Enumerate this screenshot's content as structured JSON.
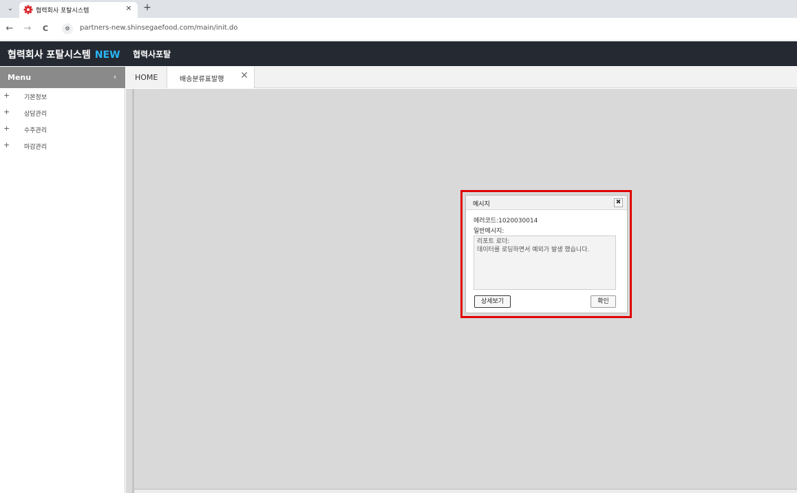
{
  "browser": {
    "tab_menu_glyph": "⌄",
    "tab_title": "협력회사 포탈시스템",
    "tab_close_glyph": "×",
    "new_tab_glyph": "+",
    "back_glyph": "←",
    "forward_glyph": "→",
    "reload_glyph": "C",
    "site_info_glyph": "⚙",
    "url": "partners-new.shinsegaefood.com/main/init.do",
    "favicon_color": "#d7262a"
  },
  "app": {
    "brand": "협력회사 포탈시스템",
    "brand_badge": "NEW",
    "portal_link": "협력사포탈",
    "header_color": "#252932",
    "accent_color": "#29b6f6"
  },
  "sidebar": {
    "menu_title": "Menu",
    "collapse_glyph": "‹",
    "items": [
      {
        "label": "기본정보",
        "icon": "+"
      },
      {
        "label": "상담관리",
        "icon": "+"
      },
      {
        "label": "수주관리",
        "icon": "+"
      },
      {
        "label": "마감관리",
        "icon": "+"
      }
    ]
  },
  "content_tabs": {
    "home": "HOME",
    "active": "배송분류표발행",
    "close_glyph": "✕"
  },
  "dialog": {
    "title": "메시지",
    "close_glyph": "✖",
    "error_code": "에러코드:1020030014",
    "general_label": "일반메시지:",
    "message_lines": [
      "리포트 로더:",
      "데이터를 로딩하면서 예외가 발생 했습니다."
    ],
    "detail_button": "상세보기",
    "ok_button": "확인",
    "highlight_color": "#e00000"
  }
}
